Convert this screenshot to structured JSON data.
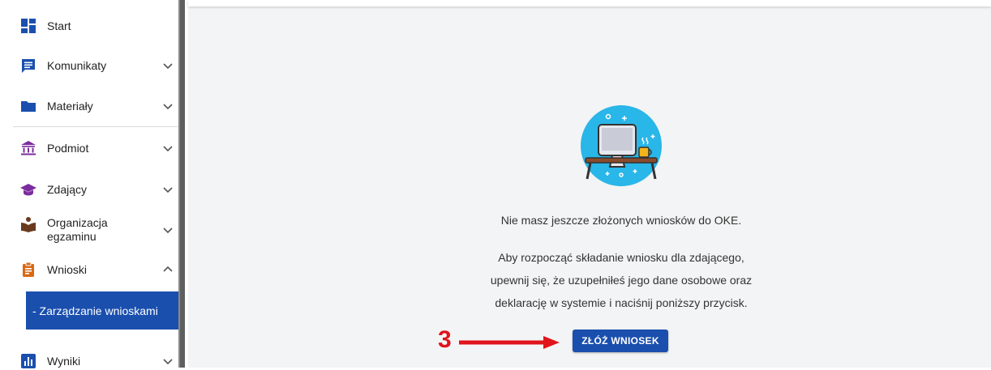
{
  "sidebar": {
    "items": [
      {
        "id": "start",
        "label": "Start",
        "icon": "dashboard-icon",
        "color": "#1a4fae"
      },
      {
        "id": "komunikaty",
        "label": "Komunikaty",
        "icon": "message-icon",
        "color": "#1a4fae"
      },
      {
        "id": "materialy",
        "label": "Materiały",
        "icon": "folder-icon",
        "color": "#1a4fae"
      },
      {
        "id": "podmiot",
        "label": "Podmiot",
        "icon": "institution-icon",
        "color": "#7b2c9e"
      },
      {
        "id": "zdajacy",
        "label": "Zdający",
        "icon": "graduation-cap-icon",
        "color": "#7b2c9e"
      },
      {
        "id": "organizacja",
        "label_line1": "Organizacja",
        "label_line2": "egzaminu",
        "icon": "person-desk-icon",
        "color": "#6b3a1e"
      },
      {
        "id": "wnioski",
        "label": "Wnioski",
        "icon": "clipboard-icon",
        "color": "#d86a14"
      },
      {
        "id": "wyniki",
        "label": "Wyniki",
        "icon": "bar-chart-icon",
        "color": "#1a4fae"
      }
    ],
    "subitem": {
      "label": "- Zarządzanie wnioskami"
    }
  },
  "main": {
    "empty_message": "Nie masz jeszcze złożonych wniosków do OKE.",
    "instructions": [
      "Aby rozpocząć składanie wniosku dla zdającego,",
      "upewnij się, że uzupełniłeś jego dane osobowe oraz",
      "deklarację w systemie i naciśnij poniższy przycisk."
    ],
    "button_label": "ZŁÓŻ WNIOSEK"
  },
  "annotation": {
    "number": "3",
    "color": "#e0141b"
  },
  "colors": {
    "accent": "#1a4fae",
    "background": "#f3f4f5",
    "annotation": "#e0141b"
  }
}
